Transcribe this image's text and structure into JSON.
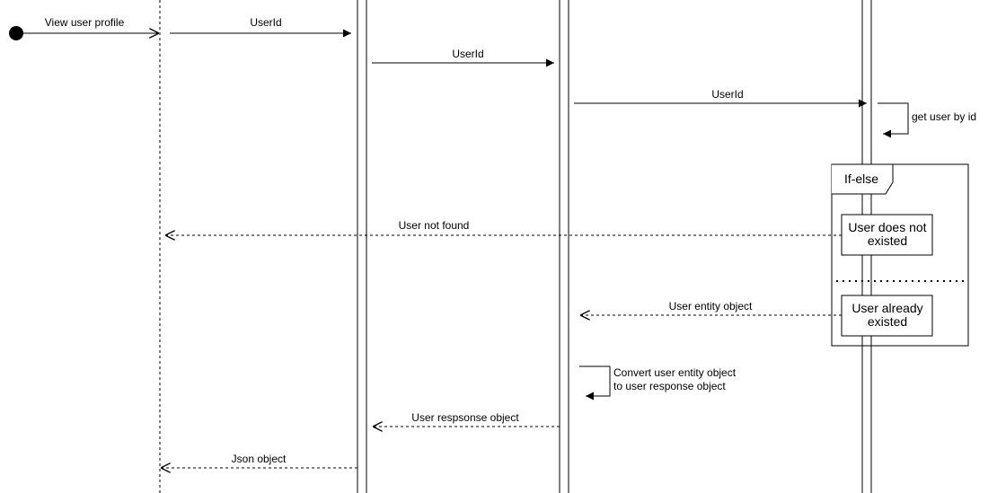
{
  "messages": {
    "view_user_profile": "View user profile",
    "userid_1": "UserId",
    "userid_2": "UserId",
    "userid_3": "UserId",
    "get_user_by_id": "get user by id",
    "user_not_found": "User not found",
    "user_entity_object": "User entity object",
    "convert_line1": "Convert user entity object",
    "convert_line2": "to user response object",
    "user_response_object": "User respsonse object",
    "json_object": "Json object"
  },
  "fragment": {
    "label": "If-else",
    "case_1_line1": "User does not",
    "case_1_line2": "existed",
    "case_2_line1": "User already",
    "case_2_line2": "existed"
  }
}
